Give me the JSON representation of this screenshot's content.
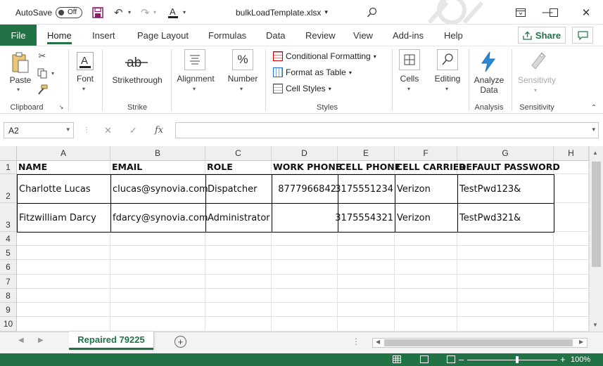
{
  "titlebar": {
    "autosave_label": "AutoSave",
    "autosave_state": "Off",
    "document_title": "bulkLoadTemplate.xlsx",
    "title_caret": "▾"
  },
  "tabs": {
    "file": "File",
    "home": "Home",
    "insert": "Insert",
    "page_layout": "Page Layout",
    "formulas": "Formulas",
    "data": "Data",
    "review": "Review",
    "view": "View",
    "addins": "Add-ins",
    "help": "Help",
    "share": "Share"
  },
  "ribbon": {
    "paste": "Paste",
    "clipboard": "Clipboard",
    "font": "Font",
    "strikethrough": "Strikethrough",
    "strike_group": "Strike",
    "alignment": "Alignment",
    "number": "Number",
    "number_icon": "%",
    "conditional_formatting": "Conditional Formatting",
    "format_as_table": "Format as Table",
    "cell_styles": "Cell Styles",
    "styles_group": "Styles",
    "cells": "Cells",
    "editing": "Editing",
    "analyze_data": "Analyze Data",
    "analyze_data_line1": "Analyze",
    "analyze_data_line2": "Data",
    "analysis_group": "Analysis",
    "sensitivity": "Sensitivity",
    "sensitivity_group": "Sensitivity"
  },
  "formula_bar": {
    "name_box": "A2",
    "fx": "fx",
    "content": ""
  },
  "sheet": {
    "columns": [
      "A",
      "B",
      "C",
      "D",
      "E",
      "F",
      "G",
      "H"
    ],
    "rows": [
      "1",
      "2",
      "3",
      "4",
      "5",
      "6",
      "7",
      "8",
      "9",
      "10"
    ],
    "headers": [
      "NAME",
      "EMAIL",
      "ROLE",
      "WORK PHONE",
      "CELL PHONE",
      "CELL CARRIER",
      "DEFAULT PASSWORD"
    ],
    "data": [
      [
        "Charlotte Lucas",
        "clucas@synovia.com",
        "Dispatcher",
        "8777966842",
        "3175551234",
        "Verizon",
        "TestPwd123&"
      ],
      [
        "Fitzwilliam Darcy",
        "fdarcy@synovia.com",
        "Administrator",
        "",
        "3175554321",
        "Verizon",
        "TestPwd321&"
      ]
    ]
  },
  "sheet_tab": {
    "name": "Repaired 79225"
  },
  "status": {
    "zoom": "100%"
  },
  "colors": {
    "excel_green": "#217346"
  }
}
